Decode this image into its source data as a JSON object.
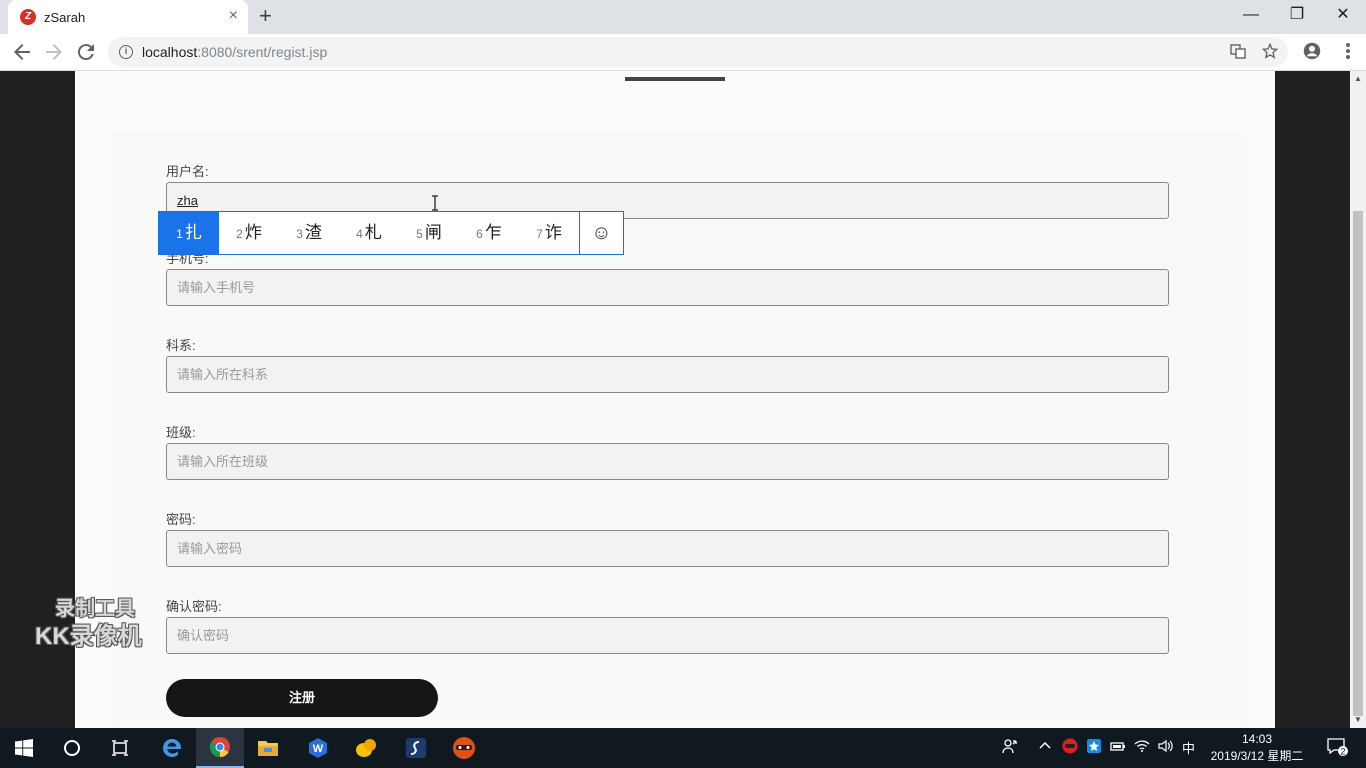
{
  "browser": {
    "tab_title": "zSarah",
    "tab_favicon": "Z",
    "tab_close": "×",
    "new_tab": "+",
    "url_host": "localhost",
    "url_rest": ":8080/srent/regist.jsp",
    "window_minimize": "—",
    "window_restore": "❐",
    "window_close": "✕"
  },
  "form": {
    "username": {
      "label": "用户名:",
      "value": "zha"
    },
    "phone": {
      "label": "手机号:",
      "placeholder": "请输入手机号"
    },
    "department": {
      "label": "科系:",
      "placeholder": "请输入所在科系"
    },
    "class": {
      "label": "班级:",
      "placeholder": "请输入所在班级"
    },
    "password": {
      "label": "密码:",
      "placeholder": "请输入密码"
    },
    "confirm": {
      "label": "确认密码:",
      "placeholder": "确认密码"
    },
    "submit_label": "注册"
  },
  "ime": {
    "candidates": [
      {
        "num": "1",
        "char": "扎"
      },
      {
        "num": "2",
        "char": "炸"
      },
      {
        "num": "3",
        "char": "渣"
      },
      {
        "num": "4",
        "char": "札"
      },
      {
        "num": "5",
        "char": "闸"
      },
      {
        "num": "6",
        "char": "乍"
      },
      {
        "num": "7",
        "char": "诈"
      }
    ],
    "selected_index": 0,
    "emoji": "☺"
  },
  "watermark": {
    "line1": "录制工具",
    "line2": "KK录像机"
  },
  "taskbar": {
    "ime_indicator": "中",
    "time": "14:03",
    "date": "2019/3/12 星期二",
    "notification_count": "2"
  },
  "icons": [
    "back-icon",
    "forward-icon",
    "reload-icon",
    "info-icon",
    "translate-icon",
    "star-icon",
    "account-icon",
    "menu-icon",
    "emoji-icon",
    "windows-start-icon",
    "search-circle-icon",
    "task-view-icon",
    "edge-icon",
    "chrome-icon",
    "explorer-icon",
    "wps-icon",
    "app-icon",
    "sublime-icon",
    "recorder-icon"
  ]
}
